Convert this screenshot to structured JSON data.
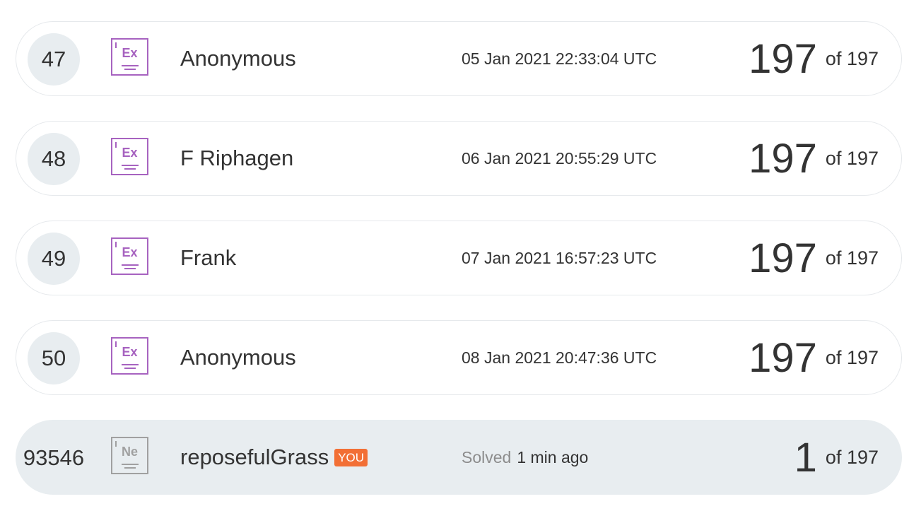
{
  "rows": [
    {
      "rank": "47",
      "level": "Ex",
      "name": "Anonymous",
      "date": "05 Jan 2021 22:33:04 UTC",
      "score": "197",
      "of": "of 197"
    },
    {
      "rank": "48",
      "level": "Ex",
      "name": "F Riphagen",
      "date": "06 Jan 2021 20:55:29 UTC",
      "score": "197",
      "of": "of 197"
    },
    {
      "rank": "49",
      "level": "Ex",
      "name": "Frank",
      "date": "07 Jan 2021 16:57:23 UTC",
      "score": "197",
      "of": "of 197"
    },
    {
      "rank": "50",
      "level": "Ex",
      "name": "Anonymous",
      "date": "08 Jan 2021 20:47:36 UTC",
      "score": "197",
      "of": "of 197"
    }
  ],
  "me": {
    "rank": "93546",
    "level": "Ne",
    "name": "reposefulGrass",
    "badge": "YOU",
    "solved_label": "Solved",
    "time": "1 min ago",
    "score": "1",
    "of": "of 197"
  },
  "colors": {
    "expert_level": "#a763c0",
    "newbie_level": "#a0a0a0",
    "you_badge": "#f26f35",
    "current_row_bg": "#e8edf0"
  },
  "icons": {
    "level_icon": "level-badge-icon"
  }
}
